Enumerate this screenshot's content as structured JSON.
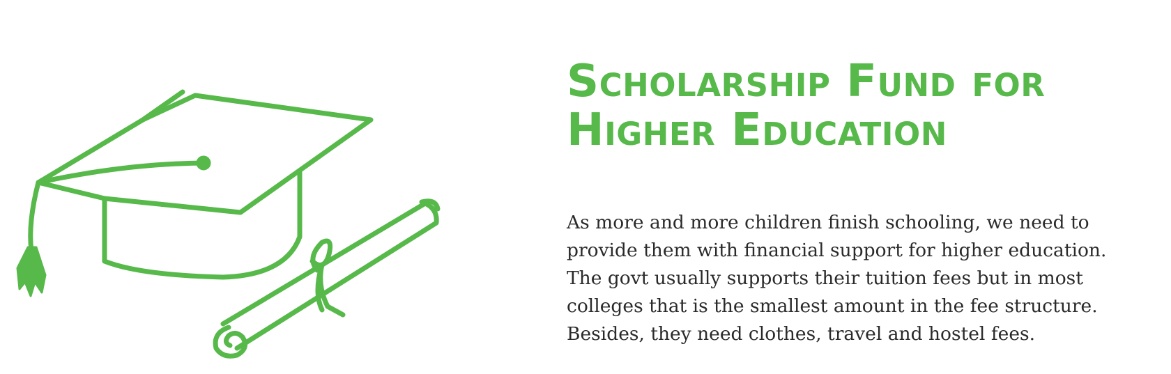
{
  "title": {
    "line1": "Scholarship Fund for",
    "line2": "Higher Education"
  },
  "body": {
    "lines": [
      "As more and more children finish schooling, we need to",
      "provide them with financial support for higher education.",
      "The govt usually supports their tuition fees but in most",
      "colleges that is the smallest amount in the fee structure.",
      "Besides, they need clothes, travel and hostel fees."
    ]
  },
  "colors": {
    "accent": "#56b94a",
    "text": "#2a2a2a",
    "background": "#ffffff"
  },
  "icons": [
    "graduation-cap-icon",
    "diploma-scroll-icon"
  ]
}
